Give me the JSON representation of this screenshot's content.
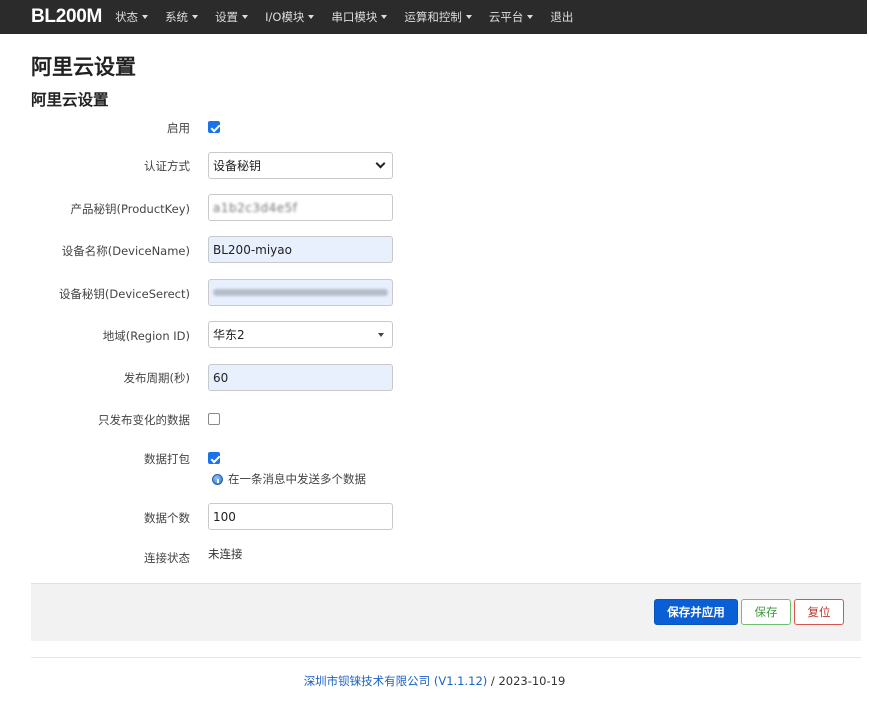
{
  "nav": {
    "brand": "BL200M",
    "items": [
      {
        "label": "状态",
        "dropdown": true
      },
      {
        "label": "系统",
        "dropdown": true
      },
      {
        "label": "设置",
        "dropdown": true
      },
      {
        "label": "I/O模块",
        "dropdown": true
      },
      {
        "label": "串口模块",
        "dropdown": true
      },
      {
        "label": "运算和控制",
        "dropdown": true
      },
      {
        "label": "云平台",
        "dropdown": true
      },
      {
        "label": "退出",
        "dropdown": false
      }
    ]
  },
  "page": {
    "title": "阿里云设置",
    "section_title": "阿里云设置"
  },
  "form": {
    "enable": {
      "label": "启用",
      "checked": true
    },
    "auth_mode": {
      "label": "认证方式",
      "value": "设备秘钥"
    },
    "product_key": {
      "label": "产品秘钥(ProductKey)",
      "value": "a1b2c3d4e5f"
    },
    "device_name": {
      "label": "设备名称(DeviceName)",
      "value": "BL200-miyao"
    },
    "device_secret": {
      "label": "设备秘钥(DeviceSerect)",
      "value": ""
    },
    "region": {
      "label": "地域(Region ID)",
      "value": "华东2"
    },
    "publish_period": {
      "label": "发布周期(秒)",
      "value": "60"
    },
    "publish_changed_only": {
      "label": "只发布变化的数据",
      "checked": false
    },
    "data_packing": {
      "label": "数据打包",
      "checked": true,
      "hint": "在一条消息中发送多个数据"
    },
    "data_count": {
      "label": "数据个数",
      "value": "100"
    },
    "connection_status": {
      "label": "连接状态",
      "value": "未连接"
    }
  },
  "actions": {
    "save_apply": "保存并应用",
    "save": "保存",
    "reset": "复位"
  },
  "footer": {
    "company": "深圳市钡铼技术有限公司 (V1.1.12)",
    "date": " / 2023-10-19"
  },
  "colors": {
    "navbar_bg": "#2b2b2b",
    "primary": "#0a5fd6",
    "success": "#3c9a3c",
    "danger": "#c0392b",
    "input_fill": "#e8f0fe"
  }
}
